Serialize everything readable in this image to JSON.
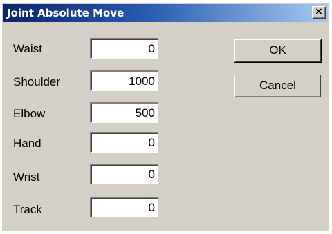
{
  "window": {
    "title": "Joint Absolute Move",
    "close_label": "×"
  },
  "fields": [
    {
      "label": "Waist",
      "value": "0"
    },
    {
      "label": "Shoulder",
      "value": "1000"
    },
    {
      "label": "Elbow",
      "value": "500"
    },
    {
      "label": "Hand",
      "value": "0"
    },
    {
      "label": "Wrist",
      "value": "0"
    },
    {
      "label": "Track",
      "value": "0"
    }
  ],
  "buttons": {
    "ok_label": "OK",
    "cancel_label": "Cancel"
  },
  "colors": {
    "face": "#d4d0c8",
    "title_start": "#0a246a",
    "title_end": "#a6caf0"
  }
}
